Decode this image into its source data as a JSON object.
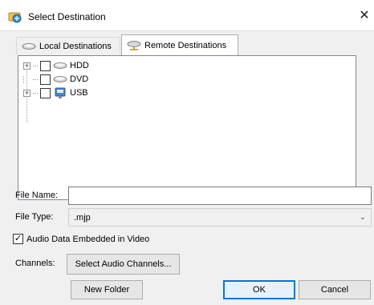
{
  "window": {
    "title": "Select Destination",
    "close_glyph": "✕"
  },
  "tabs": [
    {
      "label": "Local Destinations",
      "icon": "drive-icon",
      "active": false
    },
    {
      "label": "Remote Destinations",
      "icon": "network-drive-icon",
      "active": true
    }
  ],
  "tree": [
    {
      "label": "HDD",
      "expandable": true,
      "checked": false,
      "icon": "drive-icon"
    },
    {
      "label": "DVD",
      "expandable": false,
      "checked": false,
      "icon": "drive-icon"
    },
    {
      "label": "USB",
      "expandable": true,
      "checked": false,
      "icon": "usb-icon"
    }
  ],
  "form": {
    "file_name_label": "File Name:",
    "file_name_value": "",
    "file_type_label": "File Type:",
    "file_type_value": ".mjp",
    "audio_embedded_label": "Audio Data Embedded in Video",
    "audio_embedded_checked": true,
    "channels_label": "Channels:",
    "select_channels_label": "Select Audio Channels..."
  },
  "buttons": {
    "new_folder": "New Folder",
    "ok": "OK",
    "cancel": "Cancel"
  },
  "colors": {
    "accent": "#0078d7",
    "dialog_bg": "#f0f0f0"
  }
}
